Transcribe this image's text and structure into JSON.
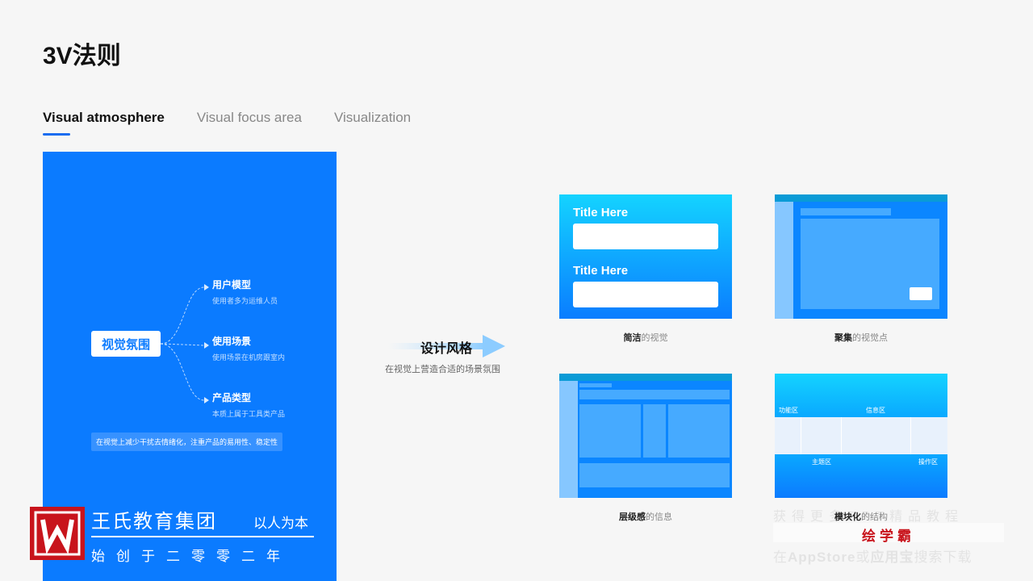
{
  "page_title": "3V法则",
  "tabs": [
    {
      "label": "Visual atmosphere",
      "active": true
    },
    {
      "label": "Visual focus area",
      "active": false
    },
    {
      "label": "Visualization",
      "active": false
    }
  ],
  "left_panel": {
    "center_node": "视觉氛围",
    "branches": [
      {
        "title": "用户模型",
        "sub": "使用者多为运维人员"
      },
      {
        "title": "使用场景",
        "sub": "使用场景在机房跟室内"
      },
      {
        "title": "产品类型",
        "sub": "本质上属于工具类产品"
      }
    ],
    "note": "在视觉上减少干扰去情绪化，注重产品的易用性、稳定性"
  },
  "middle": {
    "title": "设计风格",
    "subtitle": "在视觉上营造合适的场景氛围"
  },
  "cards": [
    {
      "title_1": "Title Here",
      "title_2": "Title Here",
      "caption_bold": "简洁",
      "caption_rest": "的视觉"
    },
    {
      "caption_bold": "聚集",
      "caption_rest": "的视觉点"
    },
    {
      "caption_bold": "层级感",
      "caption_rest": "的信息"
    },
    {
      "caption_bold": "模块化",
      "caption_rest": "的结构",
      "labels": {
        "func": "功能区",
        "info": "信息区",
        "main": "主题区",
        "ops": "操作区"
      }
    }
  ],
  "brand": {
    "name": "王氏教育集团",
    "slogan": "以人为本",
    "since": "始创于二零零二年"
  },
  "watermark": {
    "line1": "获得更多PPT精品教程",
    "line2": "绘学霸",
    "line3_prefix": "在",
    "line3_store": "AppStore",
    "line3_mid": "或",
    "line3_app": "应用宝",
    "line3_suffix": "搜索下载"
  },
  "colors": {
    "accent": "#1a6cf0",
    "panel_blue": "#0b7bff",
    "logo_red": "#c8141c"
  }
}
